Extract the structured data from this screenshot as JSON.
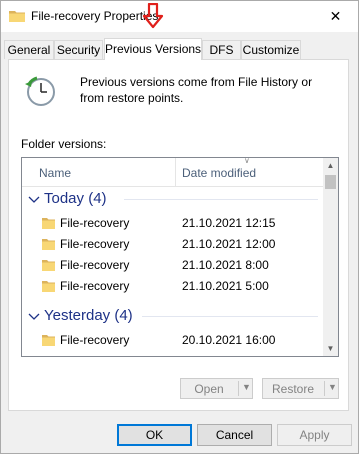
{
  "window": {
    "title": "File-recovery Properties",
    "close_glyph": "✕"
  },
  "tabs": [
    {
      "label": "General",
      "active": false
    },
    {
      "label": "Security",
      "active": false
    },
    {
      "label": "Previous Versions",
      "active": true
    },
    {
      "label": "DFS",
      "active": false
    },
    {
      "label": "Customize",
      "active": false
    }
  ],
  "info": {
    "text": "Previous versions come from File History or from restore points."
  },
  "folder_versions": {
    "label": "Folder versions:",
    "columns": {
      "name": "Name",
      "date": "Date modified"
    },
    "groups": [
      {
        "label": "Today (4)",
        "rows": [
          {
            "name": "File-recovery",
            "date": "21.10.2021 12:15"
          },
          {
            "name": "File-recovery",
            "date": "21.10.2021 12:00"
          },
          {
            "name": "File-recovery",
            "date": "21.10.2021 8:00"
          },
          {
            "name": "File-recovery",
            "date": "21.10.2021 5:00"
          }
        ]
      },
      {
        "label": "Yesterday (4)",
        "rows": [
          {
            "name": "File-recovery",
            "date": "20.10.2021 16:00"
          }
        ]
      }
    ]
  },
  "actions": {
    "open": "Open",
    "restore": "Restore"
  },
  "footer": {
    "ok": "OK",
    "cancel": "Cancel",
    "apply": "Apply"
  },
  "colors": {
    "accent": "#0078d7",
    "group_header": "#1e3287",
    "arrow": "#e0201b",
    "folder": "#f8d775"
  }
}
